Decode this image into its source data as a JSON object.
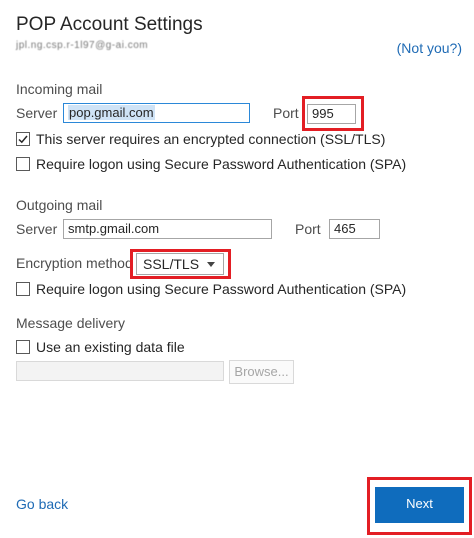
{
  "header": {
    "title": "POP Account Settings",
    "account_email": "jpl.ng.csp.r-1l97@g-ai.com",
    "not_you_link": "(Not you?)"
  },
  "incoming": {
    "section_label": "Incoming mail",
    "server_label": "Server",
    "server_value": "pop.gmail.com",
    "port_label": "Port",
    "port_value": "995",
    "encrypted_checkbox_label": "This server requires an encrypted connection (SSL/TLS)",
    "encrypted_checked": true,
    "spa_checkbox_label": "Require logon using Secure Password Authentication (SPA)",
    "spa_checked": false
  },
  "outgoing": {
    "section_label": "Outgoing mail",
    "server_label": "Server",
    "server_value": "smtp.gmail.com",
    "port_label": "Port",
    "port_value": "465",
    "encryption_label": "Encryption method",
    "encryption_value": "SSL/TLS",
    "spa_checkbox_label": "Require logon using Secure Password Authentication (SPA)",
    "spa_checked": false
  },
  "delivery": {
    "section_label": "Message delivery",
    "existing_file_checkbox_label": "Use an existing data file",
    "existing_file_checked": false,
    "file_path_value": "",
    "browse_label": "Browse..."
  },
  "footer": {
    "go_back_label": "Go back",
    "next_label": "Next"
  },
  "colors": {
    "accent": "#0f6cbd",
    "link": "#1f6bb5",
    "highlight_box": "#e31e24"
  }
}
